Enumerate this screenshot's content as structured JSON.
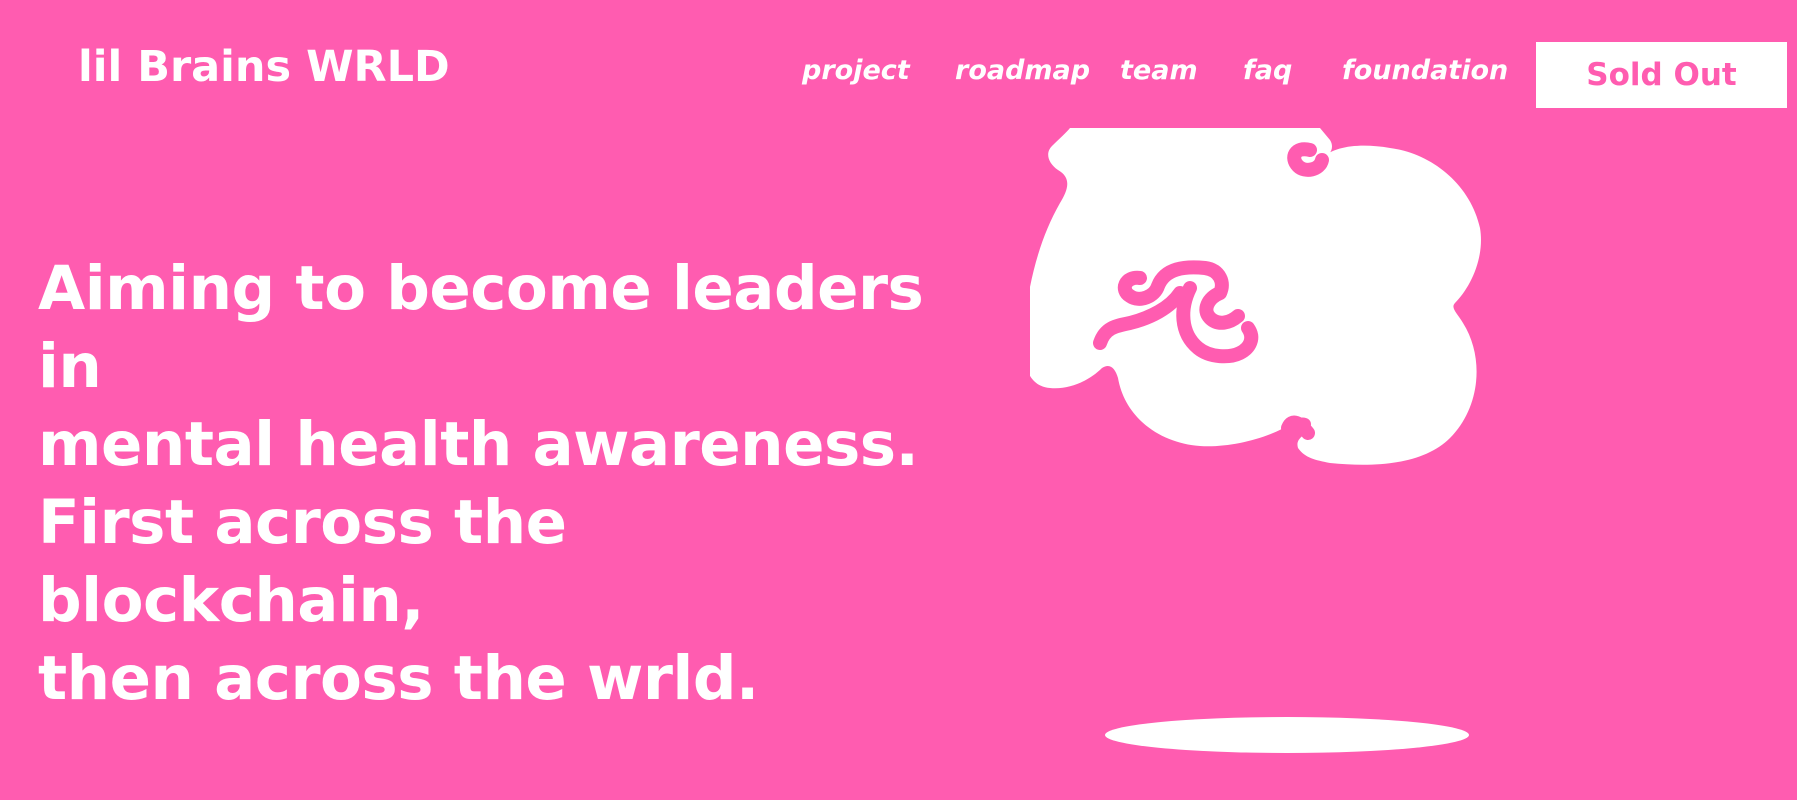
{
  "header": {
    "logo_text": "lil Brains WRLD",
    "nav": [
      {
        "label": "project"
      },
      {
        "label": "roadmap"
      },
      {
        "label": "team"
      },
      {
        "label": "faq"
      },
      {
        "label": "foundation"
      }
    ],
    "cta_label": "Sold Out"
  },
  "hero": {
    "lines": [
      "Aiming to become leaders in",
      "mental health awareness.",
      "First across the blockchain,",
      "then across the wrld."
    ]
  },
  "colors": {
    "background": "#ff5cb0",
    "foreground": "#ffffff"
  },
  "icons": {
    "brain": "brain-illustration",
    "shadow": "floor-shadow"
  }
}
